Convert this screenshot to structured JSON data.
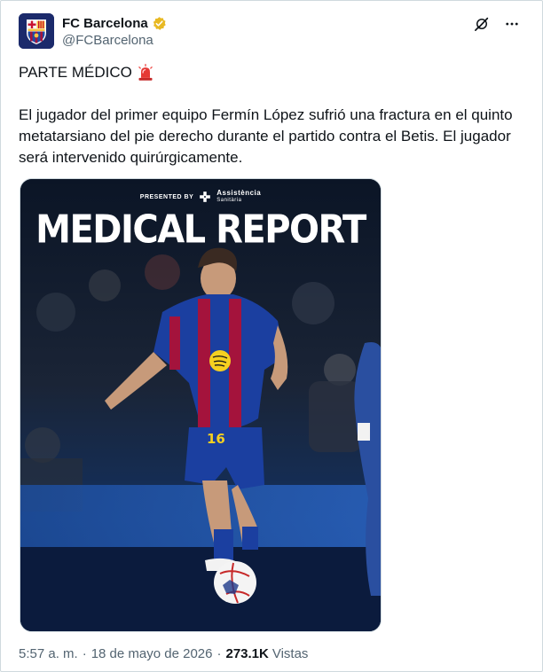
{
  "account": {
    "display_name": "FC Barcelona",
    "handle": "@FCBarcelona",
    "verified": true,
    "verified_color": "#e8b923"
  },
  "header_icons": [
    "grok-icon",
    "more-icon"
  ],
  "post": {
    "title": "PARTE MÉDICO",
    "title_emoji": "siren-icon",
    "body": "El jugador del primer equipo Fermín López sufrió una fractura en el quinto metatarsiano del pie derecho durante el partido contra el Betis. El jugador será intervenido quirúrgicamente."
  },
  "media": {
    "presented_by": "PRESENTED BY",
    "sponsor_name": "Assistència",
    "sponsor_sub": "Sanitària",
    "headline": "MEDICAL REPORT",
    "shirt_number": "16"
  },
  "footer": {
    "time": "5:57 a. m.",
    "separator": "·",
    "date": "18 de mayo de 2026",
    "views_count": "273.1K",
    "views_label": "Vistas"
  },
  "colors": {
    "text": "#0f1419",
    "muted": "#536471",
    "border": "#cfd9de",
    "barca_blue": "#1b3fa0",
    "barca_red": "#a4133c"
  }
}
